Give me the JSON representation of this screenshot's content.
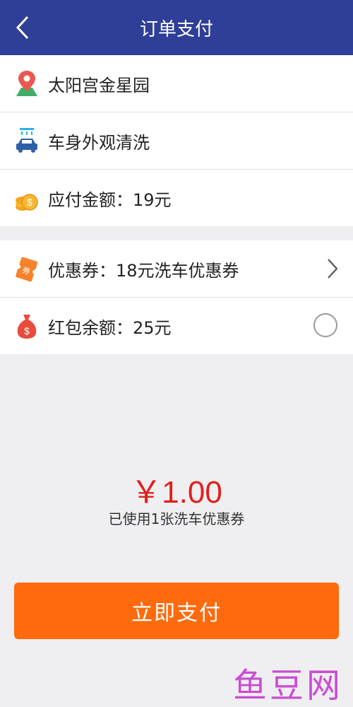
{
  "header": {
    "title": "订单支付",
    "back_icon": "chevron-left-icon"
  },
  "order": {
    "location": "太阳宫金星园",
    "service": "车身外观清洗",
    "amount_due": "应付金额：19元"
  },
  "discounts": {
    "coupon": "优惠券：18元洗车优惠券",
    "red_packet": "红包余额：25元",
    "red_packet_selected": false
  },
  "summary": {
    "total": "￥1.00",
    "note": "已使用1张洗车优惠券"
  },
  "actions": {
    "pay_label": "立即支付"
  },
  "watermark": "鱼豆网",
  "colors": {
    "header_bg": "#2f3f97",
    "pay_button": "#ff6a0d",
    "amount_text": "#e0201d",
    "watermark": "#c63ccf"
  }
}
